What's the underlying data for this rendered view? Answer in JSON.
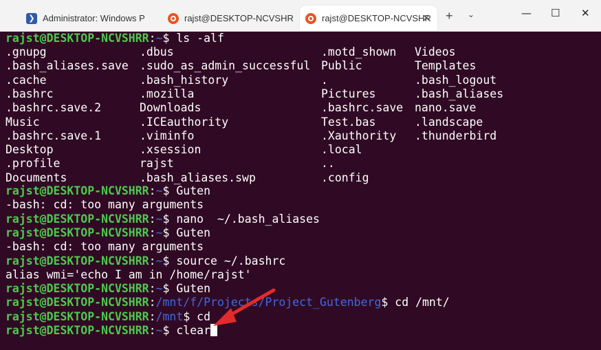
{
  "tabs": [
    {
      "label": "Administrator: Windows P",
      "icon": "powershell-icon"
    },
    {
      "label": "rajst@DESKTOP-NCVSHR",
      "icon": "ubuntu-icon"
    },
    {
      "label": "rajst@DESKTOP-NCVSHR",
      "icon": "ubuntu-icon"
    }
  ],
  "controls": {
    "new_tab": "+",
    "dropdown": "⌄",
    "minimize": "—",
    "maximize": "☐",
    "close": "✕",
    "tab_close": "✕"
  },
  "terminal": {
    "prompt_user": "rajst@DESKTOP-NCVSHRR",
    "ls_rows": [
      [
        ".gnupg",
        ".dbus",
        ".motd_shown",
        "Videos"
      ],
      [
        ".bash_aliases.save",
        ".sudo_as_admin_successful",
        "Public",
        "Templates"
      ],
      [
        ".cache",
        ".bash_history",
        ".",
        ".bash_logout"
      ],
      [
        ".bashrc",
        ".mozilla",
        "Pictures",
        ".bash_aliases"
      ],
      [
        ".bashrc.save.2",
        "Downloads",
        ".bashrc.save",
        "nano.save"
      ],
      [
        "Music",
        ".ICEauthority",
        "Test.bas",
        ".landscape"
      ],
      [
        ".bashrc.save.1",
        ".viminfo",
        ".Xauthority",
        ".thunderbird"
      ],
      [
        "Desktop",
        ".xsession",
        ".local",
        ""
      ],
      [
        ".profile",
        "rajst",
        "..",
        ""
      ],
      [
        "Documents",
        ".bash_aliases.swp",
        ".config",
        ""
      ]
    ],
    "lines": [
      {
        "type": "prompt",
        "path": "~",
        "cmd": " ls -alf"
      },
      {
        "type": "prompt",
        "path": "~",
        "cmd": " Guten"
      },
      {
        "type": "out",
        "text": "-bash: cd: too many arguments"
      },
      {
        "type": "prompt",
        "path": "~",
        "cmd": " nano  ~/.bash_aliases"
      },
      {
        "type": "prompt",
        "path": "~",
        "cmd": " Guten"
      },
      {
        "type": "out",
        "text": "-bash: cd: too many arguments"
      },
      {
        "type": "prompt",
        "path": "~",
        "cmd": " source ~/.bashrc"
      },
      {
        "type": "out",
        "text": "alias wmi='echo I am in /home/rajst'"
      },
      {
        "type": "prompt",
        "path": "~",
        "cmd": " Guten"
      },
      {
        "type": "prompt",
        "path": "/mnt/f/Projects/Project_Gutenberg",
        "cmd": " cd /mnt/"
      },
      {
        "type": "prompt",
        "path": "/mnt",
        "cmd": " cd"
      },
      {
        "type": "prompt",
        "path": "~",
        "cmd": " clear"
      }
    ]
  },
  "colors": {
    "background": "#300a24",
    "user": "#4ec94e",
    "path": "#4169e1",
    "arrow": "#e32b2b"
  }
}
